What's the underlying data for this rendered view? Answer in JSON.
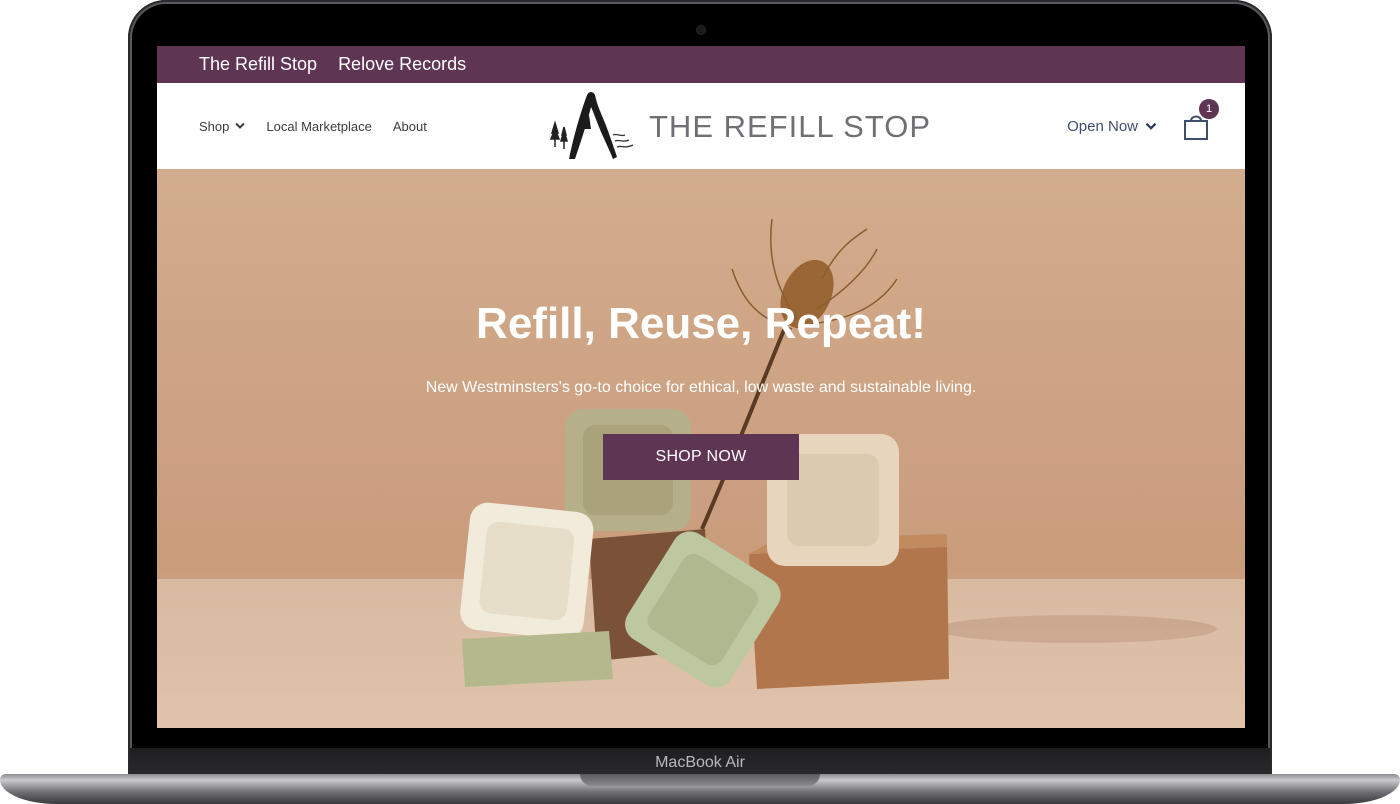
{
  "device": {
    "label": "MacBook Air"
  },
  "top_bar": {
    "links": [
      "The Refill Stop",
      "Relove Records"
    ]
  },
  "nav": {
    "items": [
      {
        "label": "Shop",
        "has_dropdown": true
      },
      {
        "label": "Local Marketplace",
        "has_dropdown": false
      },
      {
        "label": "About",
        "has_dropdown": false
      }
    ],
    "logo_text": "THE REFILL STOP",
    "status": "Open Now",
    "cart_count": "1"
  },
  "hero": {
    "title": "Refill, Reuse, Repeat!",
    "subtitle": "New Westminsters's go-to choice for ethical, low waste and sustainable living.",
    "cta_label": "SHOP NOW"
  },
  "colors": {
    "brand_plum": "#5e3553",
    "hero_tan": "#cda383",
    "nav_text": "#3f4e6e"
  },
  "icons": [
    "chevron-down-icon",
    "shopping-bag-icon",
    "mountain-logo-icon"
  ]
}
